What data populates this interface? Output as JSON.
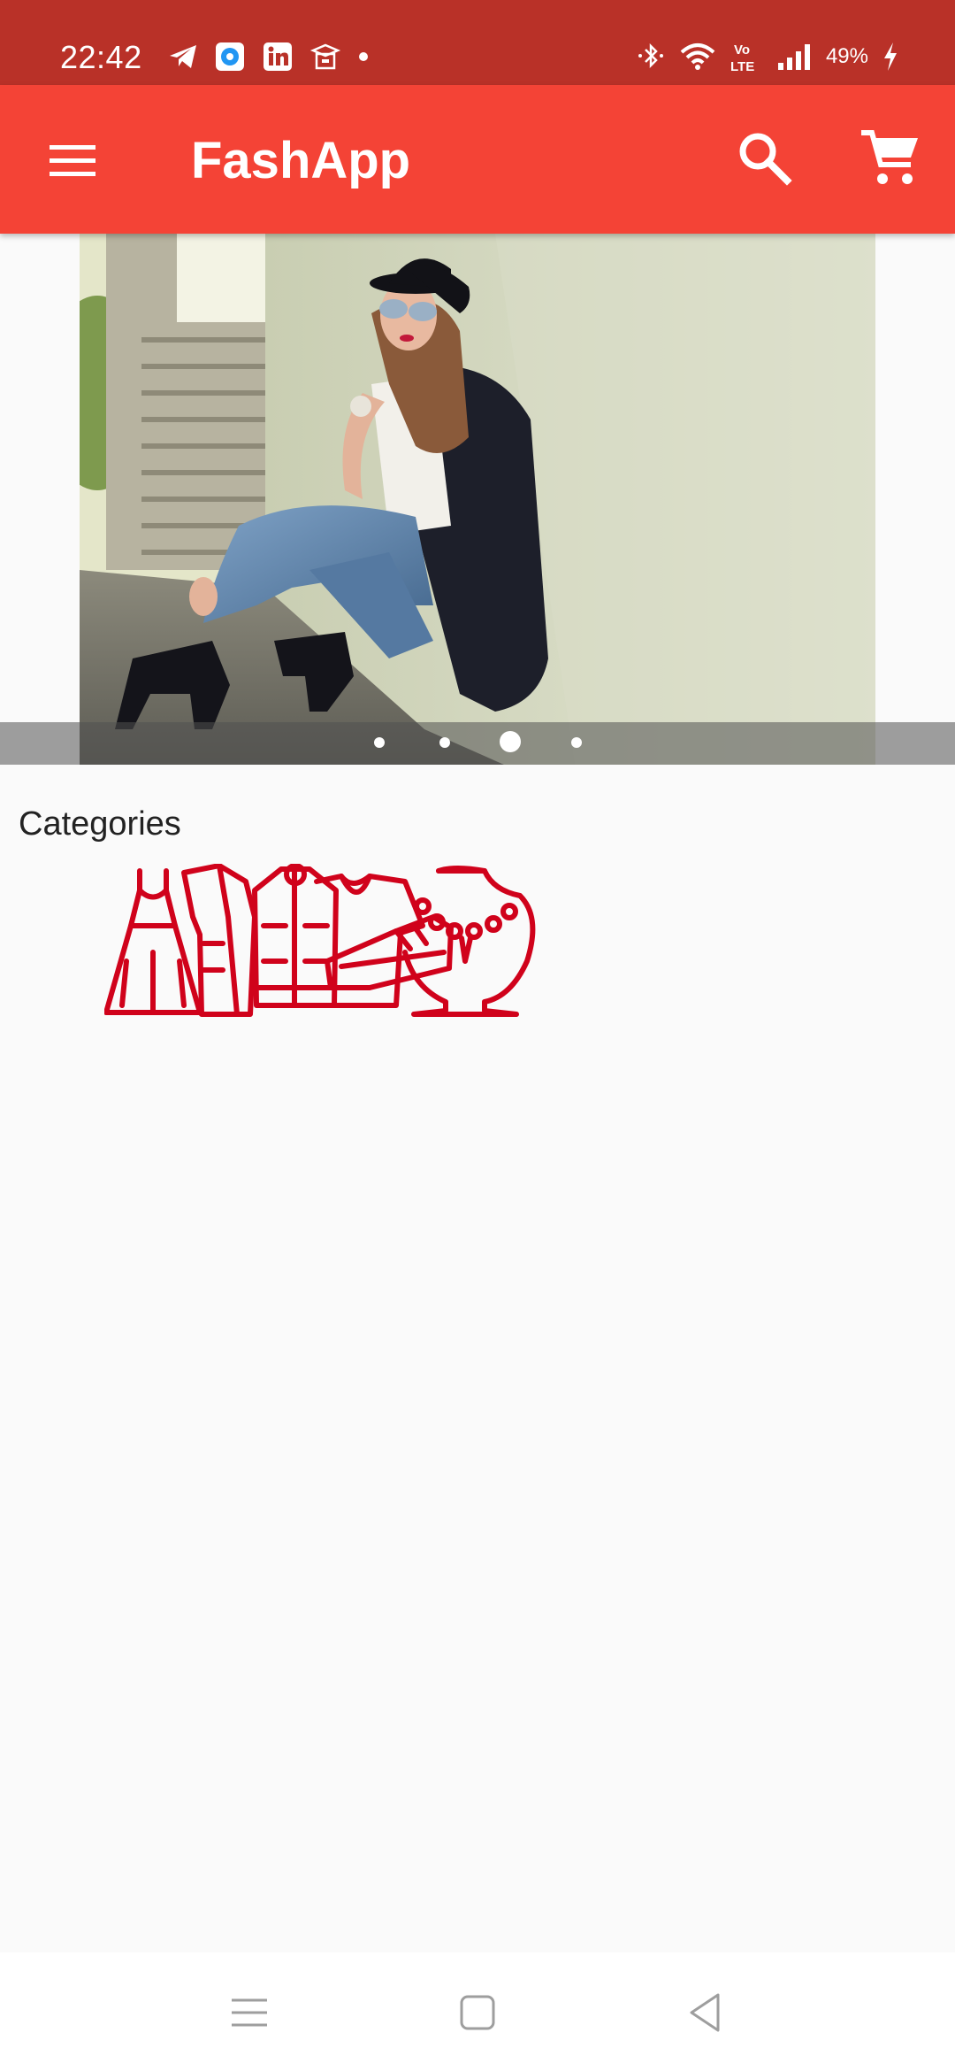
{
  "status_bar": {
    "time": "22:42",
    "battery": "49%",
    "network": "Vo LTE",
    "icons_left": [
      "telegram-icon",
      "messenger-icon",
      "linkedin-icon",
      "app-icon",
      "dot-icon"
    ],
    "icons_right": [
      "bluetooth-icon",
      "wifi-icon",
      "volte-icon",
      "signal-icon",
      "battery-charging-icon"
    ]
  },
  "app_bar": {
    "title": "FashApp",
    "menu_icon": "menu-icon",
    "search_icon": "search-icon",
    "cart_icon": "cart-icon"
  },
  "carousel": {
    "slide_count": 4,
    "active_index": 2
  },
  "categories": {
    "label": "Categories",
    "art_icons": [
      "dress-icon",
      "coat-icon",
      "jacket-icon",
      "shoe-icon",
      "necklace-icon"
    ],
    "accent_color": "#d0021b"
  },
  "nav_bar": {
    "buttons": [
      "recents-icon",
      "home-icon",
      "back-icon"
    ]
  },
  "colors": {
    "status_bar": "#b93128",
    "app_bar": "#f44336",
    "background": "#fafafa"
  }
}
